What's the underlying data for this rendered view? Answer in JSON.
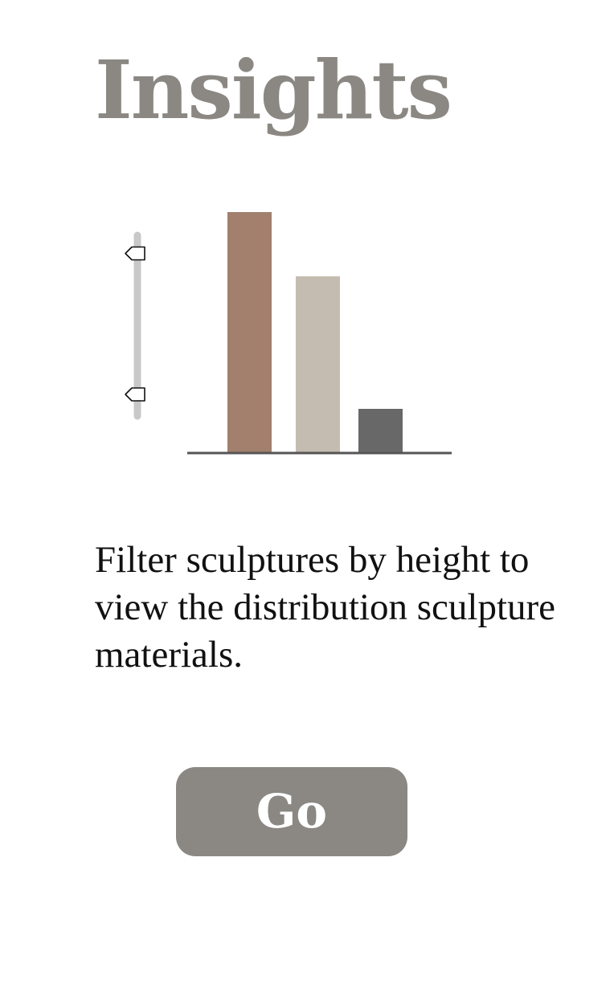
{
  "header": {
    "title": "Insights"
  },
  "filter": {
    "description": "Filter sculptures by height to view the distribution sculpture materials.",
    "slider": {
      "upper_handle": 0.9,
      "lower_handle": 0.12
    }
  },
  "action": {
    "go_label": "Go"
  },
  "chart_data": {
    "type": "bar",
    "categories": [
      "",
      "",
      ""
    ],
    "values": [
      300,
      220,
      55
    ],
    "ylim": [
      0,
      300
    ],
    "colors": [
      "#a2806d",
      "#c4bcb0",
      "#686868"
    ]
  },
  "colors": {
    "accent": "#8b8883",
    "text": "#111111",
    "slider_track": "#c8c8c8",
    "axis": "#555555"
  }
}
